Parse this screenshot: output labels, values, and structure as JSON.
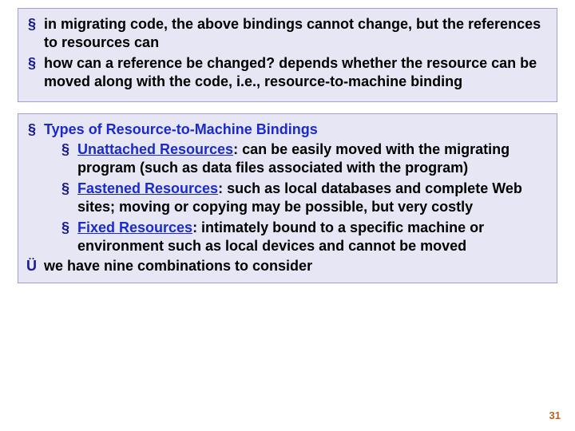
{
  "box1": {
    "item1": "in migrating code, the above bindings cannot change, but the references to resources can",
    "item2": "how can a reference be changed? depends whether the resource can be moved along with the code, i.e., resource-to-machine binding"
  },
  "box2": {
    "heading": "Types of Resource-to-Machine Bindings",
    "sub1_title": "Unattached Resources",
    "sub1_rest": ": can be easily moved with the migrating program (such as data files associated with the program)",
    "sub2_title": "Fastened Resources",
    "sub2_rest": ": such as local databases and complete Web sites; moving or copying may be possible, but very costly",
    "sub3_title": "Fixed Resources",
    "sub3_rest": ": intimately bound to a specific machine or environment such as local devices and cannot be moved",
    "arrow": "we have nine combinations to consider"
  },
  "page_number": "31"
}
